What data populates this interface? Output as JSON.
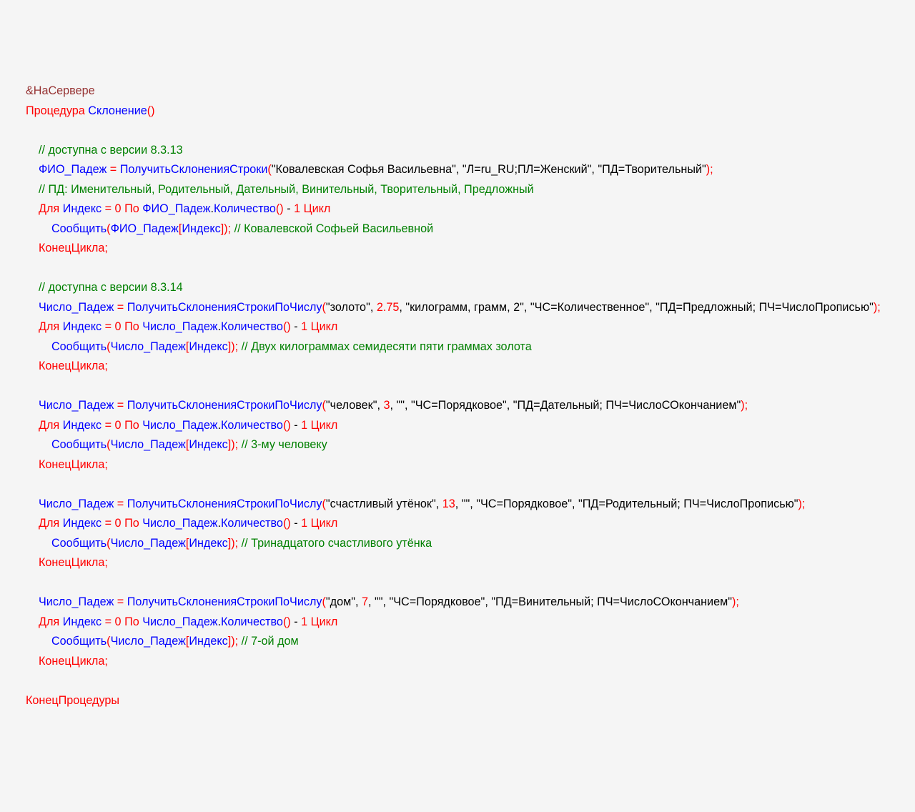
{
  "directive": "&НаСервере",
  "kwProc": "Процедура",
  "procName": "Склонение",
  "indent1": "    ",
  "indent2": "        ",
  "cmVer13": "// доступна с версии 8.3.13",
  "varFio": "ФИО_Падеж",
  "fnGetDecl": "ПолучитьСклоненияСтроки",
  "sFioName": "\"Ковалевская Софья Васильевна\"",
  "sFioLoc": "\"Л=ru_RU;ПЛ=Женский\"",
  "sFioPD": "\"ПД=Творительный\"",
  "cmPD": "// ПД: Именительный, Родительный, Дательный, Винительный, Творительный, Предложный",
  "kwFor": "Для",
  "varIdx": "Индекс",
  "n0": "0",
  "kwTo": "По",
  "mCount": "Количество",
  "n1": "1",
  "kwLoop": "Цикл",
  "fnMsg": "Сообщить",
  "cmFioRes": "// Ковалевской Софьей Васильевной",
  "kwEndLoop": "КонецЦикла",
  "cmVer14": "// доступна с версии 8.3.14",
  "varNum": "Число_Падеж",
  "fnGetDeclNum": "ПолучитьСклоненияСтрокиПоЧислу",
  "b1s1": "\"золото\"",
  "b1n": "2.75",
  "b1s2": "\"килограмм, грамм, 2\"",
  "b1s3": "\"ЧС=Количественное\"",
  "b1s4": "\"ПД=Предложный; ПЧ=ЧислоПрописью\"",
  "cmB1": "// Двух килограммах семидесяти пяти граммах золота",
  "b2s1": "\"человек\"",
  "b2n": "3",
  "sEmpty": "\"\"",
  "b2s3": "\"ЧС=Порядковое\"",
  "b2s4": "\"ПД=Дательный; ПЧ=ЧислоСОкончанием\"",
  "cmB2": "// 3-му человеку",
  "b3s1": "\"счастливый утёнок\"",
  "b3n": "13",
  "b3s4": "\"ПД=Родительный; ПЧ=ЧислоПрописью\"",
  "cmB3": "// Тринадцатого счастливого утёнка",
  "b4s1": "\"дом\"",
  "b4n": "7",
  "b4s4": "\"ПД=Винительный; ПЧ=ЧислоСОкончанием\"",
  "cmB4": "// 7-ой дом",
  "kwEndProc": "КонецПроцедуры"
}
